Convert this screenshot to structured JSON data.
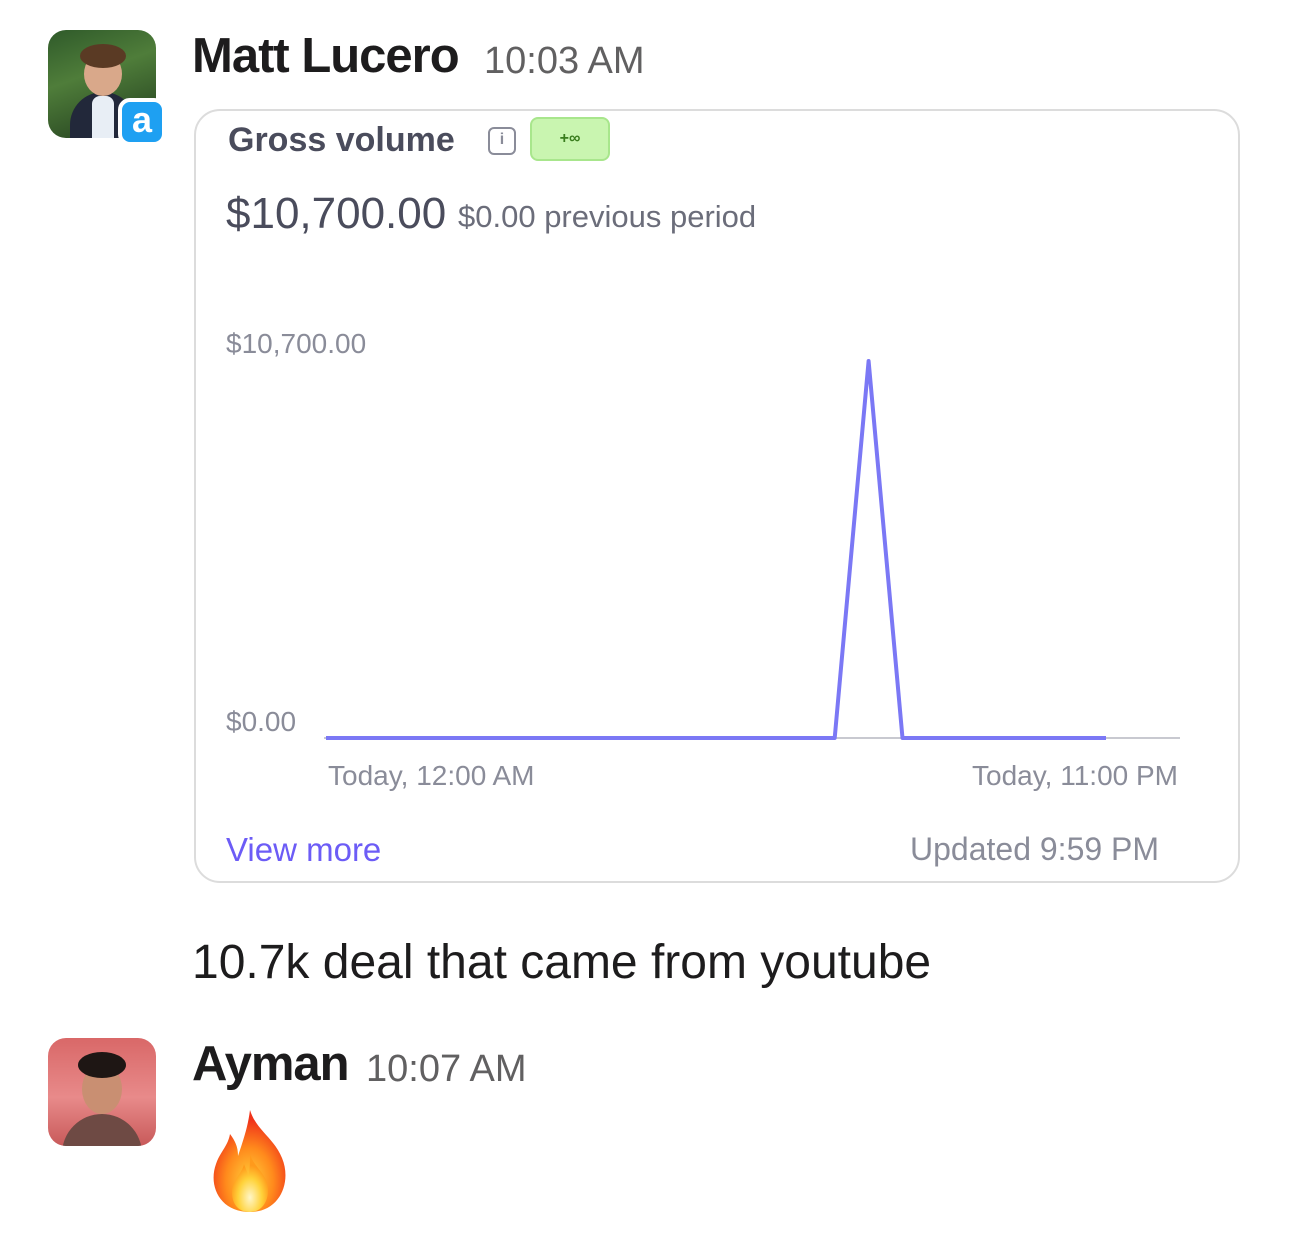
{
  "messages": [
    {
      "author": "Matt Lucero",
      "time": "10:03 AM",
      "avatar_badge": "a",
      "attachment": {
        "title": "Gross volume",
        "change_badge": "+∞",
        "total": "$10,700.00",
        "previous": "$0.00 previous period",
        "footer_link": "View more",
        "footer_updated": "Updated 9:59 PM"
      },
      "text": "10.7k deal that came from youtube"
    },
    {
      "author": "Ayman",
      "time": "10:07 AM",
      "reaction_emoji": "fire-emoji"
    }
  ],
  "chart_data": {
    "type": "line",
    "series": [
      {
        "values": [
          0,
          0,
          0,
          0,
          0,
          0,
          0,
          0,
          0,
          0,
          0,
          0,
          0,
          0,
          0,
          0,
          10700,
          0,
          0,
          0,
          0,
          0,
          0,
          0
        ]
      }
    ],
    "x": [
      "Today, 12:00 AM",
      "",
      "",
      "",
      "",
      "",
      "",
      "",
      "",
      "",
      "",
      "",
      "",
      "",
      "",
      "",
      "",
      "",
      "",
      "",
      "",
      "",
      "",
      "Today, 11:00 PM"
    ],
    "y_ticks": [
      "$10,700.00",
      "$0.00"
    ],
    "x_tick_labels": [
      "Today, 12:00 AM",
      "Today, 11:00 PM"
    ],
    "ylim": [
      0,
      10700
    ],
    "line_color": "#7b78f5",
    "grid": false
  }
}
